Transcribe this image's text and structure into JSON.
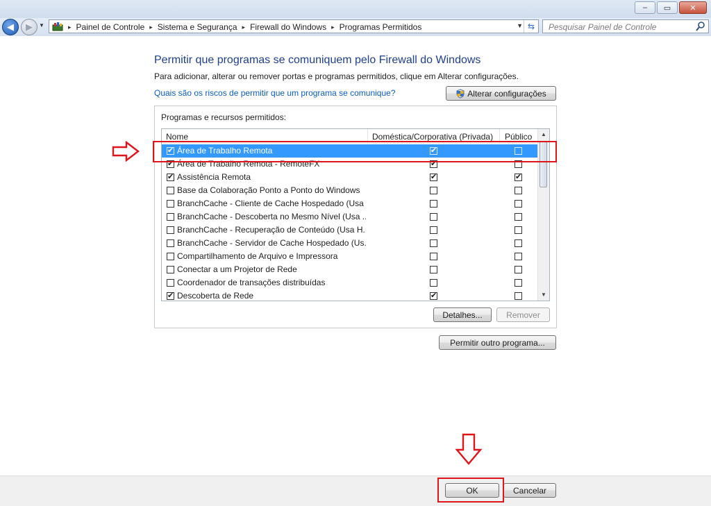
{
  "window": {
    "minimize": "‒",
    "maximize": "▭",
    "close": "✕"
  },
  "address": {
    "crumbs": [
      "Painel de Controle",
      "Sistema e Segurança",
      "Firewall do Windows",
      "Programas Permitidos"
    ],
    "separator": "▸"
  },
  "search": {
    "placeholder": "Pesquisar Painel de Controle"
  },
  "page": {
    "title": "Permitir que programas se comuniquem pelo Firewall do Windows",
    "subtitle": "Para adicionar, alterar ou remover portas e programas permitidos, clique em Alterar configurações.",
    "risk_link": "Quais são os riscos de permitir que um programa se comunique?",
    "change_settings": "Alterar configurações",
    "group_label": "Programas e recursos permitidos:"
  },
  "table": {
    "columns": [
      "Nome",
      "Doméstica/Corporativa (Privada)",
      "Público"
    ],
    "rows": [
      {
        "enabled": true,
        "name": "Área de Trabalho Remota",
        "private": true,
        "public": false,
        "selected": true
      },
      {
        "enabled": true,
        "name": "Área de Trabalho Remota - RemoteFX",
        "private": true,
        "public": false
      },
      {
        "enabled": true,
        "name": "Assistência Remota",
        "private": true,
        "public": true
      },
      {
        "enabled": false,
        "name": "Base da Colaboração Ponto a Ponto do Windows",
        "private": false,
        "public": false
      },
      {
        "enabled": false,
        "name": "BranchCache - Cliente de Cache Hospedado (Usa ...",
        "private": false,
        "public": false
      },
      {
        "enabled": false,
        "name": "BranchCache - Descoberta no Mesmo Nível (Usa ...",
        "private": false,
        "public": false
      },
      {
        "enabled": false,
        "name": "BranchCache - Recuperação de Conteúdo (Usa H...",
        "private": false,
        "public": false
      },
      {
        "enabled": false,
        "name": "BranchCache - Servidor de Cache Hospedado (Us...",
        "private": false,
        "public": false
      },
      {
        "enabled": false,
        "name": "Compartilhamento de Arquivo e Impressora",
        "private": false,
        "public": false
      },
      {
        "enabled": false,
        "name": "Conectar a um Projetor de Rede",
        "private": false,
        "public": false
      },
      {
        "enabled": false,
        "name": "Coordenador de transações distribuídas",
        "private": false,
        "public": false
      },
      {
        "enabled": true,
        "name": "Descoberta de Rede",
        "private": true,
        "public": false
      }
    ]
  },
  "buttons": {
    "details": "Detalhes...",
    "remove": "Remover",
    "allow_other": "Permitir outro programa...",
    "ok": "OK",
    "cancel": "Cancelar"
  },
  "annotations": {
    "color": "#e0141b"
  }
}
